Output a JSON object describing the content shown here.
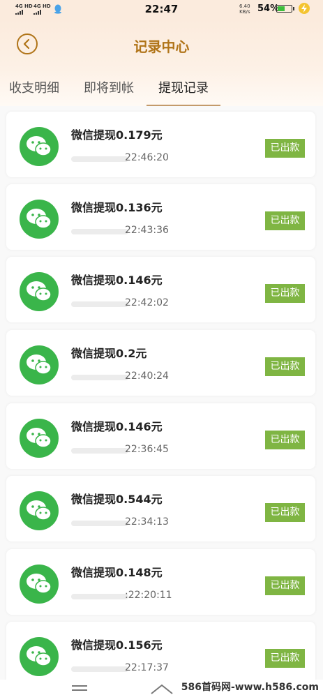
{
  "status_bar": {
    "network_1": "4G HD",
    "network_2": "4G HD",
    "time": "22:47",
    "speed_value": "6.40",
    "speed_unit": "KB/s",
    "battery": "54%",
    "battery_level": 0.54
  },
  "header": {
    "title": "记录中心"
  },
  "tabs": [
    {
      "label": "收支明细"
    },
    {
      "label": "即将到帐"
    },
    {
      "label": "提现记录",
      "active": true
    }
  ],
  "records": [
    {
      "title": "微信提现0.179元",
      "time": "22:46:20",
      "status": "已出款"
    },
    {
      "title": "微信提现0.136元",
      "time": "22:43:36",
      "status": "已出款"
    },
    {
      "title": "微信提现0.146元",
      "time": "22:42:02",
      "status": "已出款"
    },
    {
      "title": "微信提现0.2元",
      "time": "22:40:24",
      "status": "已出款"
    },
    {
      "title": "微信提现0.146元",
      "time": "22:36:45",
      "status": "已出款"
    },
    {
      "title": "微信提现0.544元",
      "time": "22:34:13",
      "status": "已出款"
    },
    {
      "title": "微信提现0.148元",
      "time": ":22:20:11",
      "status": "已出款"
    },
    {
      "title": "微信提现0.156元",
      "time": "22:17:37",
      "status": "已出款"
    }
  ],
  "colors": {
    "accent": "#b07418",
    "wechat_green": "#3ab54a",
    "badge_green": "#7fb543",
    "header_bg": "#fbebdd"
  },
  "icons": {
    "back": "chevron-left-circle-icon",
    "avatar": "wechat-icon",
    "nav_menu": "menu-icon",
    "nav_home": "home-icon"
  },
  "watermark": "586首码网-www.h586.com"
}
